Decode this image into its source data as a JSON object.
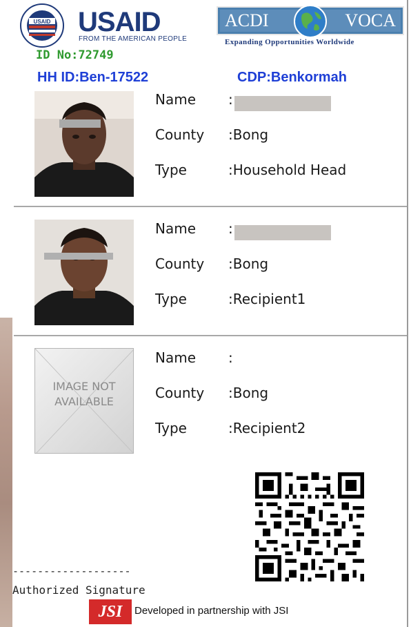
{
  "header": {
    "usaid": {
      "word": "USAID",
      "tagline": "FROM THE AMERICAN PEOPLE",
      "seal_text": "USAID"
    },
    "acdi_voca": {
      "left": "ACDI",
      "right": "VOCA",
      "tagline": "Expanding Opportunities Worldwide"
    },
    "id_no": "ID No:72749",
    "hh_id": "HH ID:Ben-17522",
    "cdp": "CDP:Benkormah"
  },
  "labels": {
    "name": "Name",
    "county": "County",
    "type": "Type"
  },
  "persons": [
    {
      "name": ":",
      "county": ":Bong",
      "type": ":Household Head",
      "photo": "photo"
    },
    {
      "name": ":",
      "county": ":Bong",
      "type": ":Recipient1",
      "photo": "photo"
    },
    {
      "name": ":",
      "county": ":Bong",
      "type": ":Recipient2",
      "photo": "placeholder",
      "placeholder_text": [
        "IMAGE NOT",
        "AVAILABLE"
      ]
    }
  ],
  "footer": {
    "signature_line": "-------------------",
    "signature_label": "Authorized Signature",
    "jsi_logo": "JSI",
    "partnership": "Developed in partnership with JSI"
  },
  "colors": {
    "usaid_blue": "#1f3a7a",
    "id_green": "#2f9a2f",
    "id_blue": "#1e3fd6",
    "jsi_red": "#d42a2a"
  }
}
